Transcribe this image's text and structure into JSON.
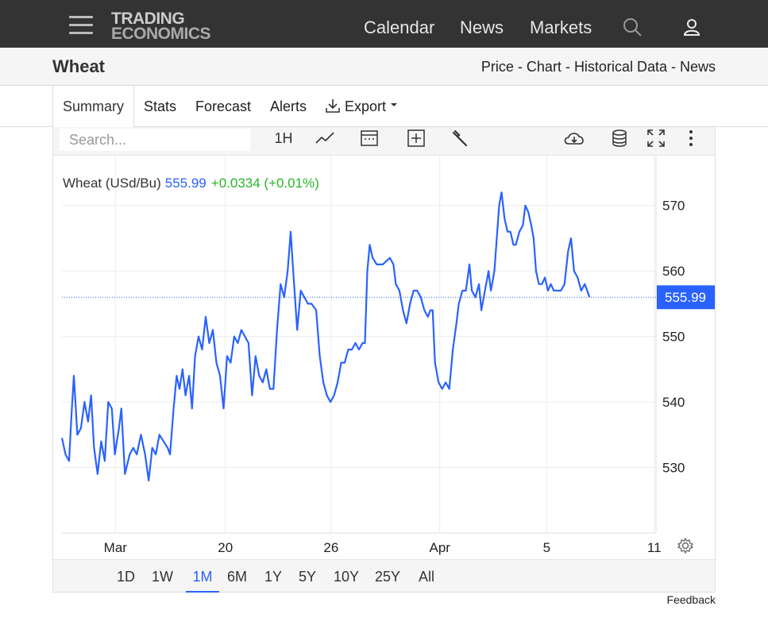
{
  "header": {
    "logo_line1": "TRADING",
    "logo_line2": "ECONOMICS",
    "nav": [
      "Calendar",
      "News",
      "Markets"
    ],
    "icons": [
      "menu-icon",
      "search-icon",
      "user-icon"
    ]
  },
  "subheader": {
    "title": "Wheat",
    "links": [
      "Price",
      "Chart",
      "Historical Data",
      "News"
    ],
    "separator": " - "
  },
  "tabs": {
    "summary": "Summary",
    "stats": "Stats",
    "forecast": "Forecast",
    "alerts": "Alerts",
    "export": "Export"
  },
  "toolbar": {
    "search_placeholder": "Search...",
    "interval": "1H",
    "icons": [
      "line-chart-icon",
      "calendar-icon",
      "add-indicator-icon",
      "wrench-icon",
      "download-icon",
      "database-icon",
      "fullscreen-icon",
      "more-icon"
    ]
  },
  "legend": {
    "name": "Wheat (USd/Bu)",
    "price": "555.99",
    "change": "+0.0334 (+0.01%)"
  },
  "chart_data": {
    "type": "line",
    "title": "Wheat (USd/Bu)",
    "last_value": 555.99,
    "last_label": "555.99",
    "ylim": [
      520,
      577
    ],
    "y_ticks": [
      530,
      540,
      550,
      560,
      570
    ],
    "x_tick_labels": [
      {
        "label": "Mar",
        "t": 0.09
      },
      {
        "label": "20",
        "t": 0.275
      },
      {
        "label": "26",
        "t": 0.453
      },
      {
        "label": "Apr",
        "t": 0.636
      },
      {
        "label": "5",
        "t": 0.816
      },
      {
        "label": "11",
        "t": 0.997
      }
    ],
    "grid": true,
    "line_color": "#2962ff",
    "series": [
      {
        "name": "Wheat (USd/Bu)",
        "points": [
          [
            0.0,
            534.5
          ],
          [
            0.006,
            532
          ],
          [
            0.012,
            531
          ],
          [
            0.016,
            538
          ],
          [
            0.02,
            544
          ],
          [
            0.026,
            535
          ],
          [
            0.032,
            536
          ],
          [
            0.038,
            540
          ],
          [
            0.044,
            537
          ],
          [
            0.049,
            541
          ],
          [
            0.054,
            533
          ],
          [
            0.06,
            529
          ],
          [
            0.066,
            534
          ],
          [
            0.072,
            531
          ],
          [
            0.078,
            540
          ],
          [
            0.084,
            539
          ],
          [
            0.089,
            532
          ],
          [
            0.096,
            536
          ],
          [
            0.1,
            539
          ],
          [
            0.106,
            529
          ],
          [
            0.114,
            532
          ],
          [
            0.12,
            533
          ],
          [
            0.126,
            532
          ],
          [
            0.133,
            535
          ],
          [
            0.14,
            532
          ],
          [
            0.146,
            528
          ],
          [
            0.152,
            533
          ],
          [
            0.158,
            532
          ],
          [
            0.164,
            535
          ],
          [
            0.171,
            534
          ],
          [
            0.178,
            533
          ],
          [
            0.182,
            532
          ],
          [
            0.188,
            539
          ],
          [
            0.193,
            544
          ],
          [
            0.198,
            542
          ],
          [
            0.203,
            545
          ],
          [
            0.208,
            541
          ],
          [
            0.214,
            544
          ],
          [
            0.219,
            539
          ],
          [
            0.224,
            547
          ],
          [
            0.23,
            550
          ],
          [
            0.236,
            548
          ],
          [
            0.242,
            553
          ],
          [
            0.248,
            549
          ],
          [
            0.254,
            551
          ],
          [
            0.26,
            546
          ],
          [
            0.266,
            544
          ],
          [
            0.272,
            539
          ],
          [
            0.278,
            547
          ],
          [
            0.284,
            546
          ],
          [
            0.29,
            550
          ],
          [
            0.296,
            549
          ],
          [
            0.302,
            551
          ],
          [
            0.308,
            550
          ],
          [
            0.314,
            549
          ],
          [
            0.32,
            541
          ],
          [
            0.326,
            547
          ],
          [
            0.332,
            544
          ],
          [
            0.338,
            543
          ],
          [
            0.344,
            545
          ],
          [
            0.35,
            542
          ],
          [
            0.356,
            542
          ],
          [
            0.362,
            551
          ],
          [
            0.368,
            558
          ],
          [
            0.374,
            556
          ],
          [
            0.38,
            560
          ],
          [
            0.385,
            566
          ],
          [
            0.39,
            559
          ],
          [
            0.396,
            551
          ],
          [
            0.402,
            557
          ],
          [
            0.408,
            556
          ],
          [
            0.414,
            555
          ],
          [
            0.42,
            555
          ],
          [
            0.428,
            554
          ],
          [
            0.434,
            547
          ],
          [
            0.44,
            543
          ],
          [
            0.446,
            541
          ],
          [
            0.452,
            540
          ],
          [
            0.458,
            541
          ],
          [
            0.464,
            543
          ],
          [
            0.47,
            546
          ],
          [
            0.476,
            546
          ],
          [
            0.482,
            548
          ],
          [
            0.488,
            548
          ],
          [
            0.494,
            549
          ],
          [
            0.5,
            548
          ],
          [
            0.506,
            549
          ],
          [
            0.51,
            549
          ],
          [
            0.514,
            560
          ],
          [
            0.518,
            564
          ],
          [
            0.523,
            562
          ],
          [
            0.53,
            561
          ],
          [
            0.54,
            561
          ],
          [
            0.552,
            562
          ],
          [
            0.558,
            561
          ],
          [
            0.562,
            558
          ],
          [
            0.568,
            557
          ],
          [
            0.574,
            554
          ],
          [
            0.58,
            552
          ],
          [
            0.586,
            555
          ],
          [
            0.592,
            557
          ],
          [
            0.598,
            557
          ],
          [
            0.604,
            556
          ],
          [
            0.61,
            554
          ],
          [
            0.616,
            553
          ],
          [
            0.62,
            554
          ],
          [
            0.624,
            554
          ],
          [
            0.628,
            546
          ],
          [
            0.634,
            543
          ],
          [
            0.64,
            542
          ],
          [
            0.646,
            543
          ],
          [
            0.652,
            542
          ],
          [
            0.658,
            548
          ],
          [
            0.664,
            552
          ],
          [
            0.668,
            555
          ],
          [
            0.674,
            557
          ],
          [
            0.68,
            557
          ],
          [
            0.686,
            561
          ],
          [
            0.69,
            557
          ],
          [
            0.696,
            556
          ],
          [
            0.702,
            558
          ],
          [
            0.706,
            554
          ],
          [
            0.712,
            557
          ],
          [
            0.718,
            560
          ],
          [
            0.722,
            557
          ],
          [
            0.728,
            560
          ],
          [
            0.732,
            565
          ],
          [
            0.736,
            570
          ],
          [
            0.74,
            572
          ],
          [
            0.745,
            568
          ],
          [
            0.75,
            566
          ],
          [
            0.755,
            566
          ],
          [
            0.76,
            564
          ],
          [
            0.764,
            564
          ],
          [
            0.77,
            566
          ],
          [
            0.776,
            567
          ],
          [
            0.78,
            570
          ],
          [
            0.785,
            569
          ],
          [
            0.79,
            567
          ],
          [
            0.794,
            565
          ],
          [
            0.798,
            560
          ],
          [
            0.803,
            558
          ],
          [
            0.808,
            558
          ],
          [
            0.813,
            559
          ],
          [
            0.818,
            557
          ],
          [
            0.823,
            558
          ],
          [
            0.828,
            557
          ],
          [
            0.834,
            557
          ],
          [
            0.84,
            557
          ],
          [
            0.846,
            558
          ],
          [
            0.852,
            563
          ],
          [
            0.857,
            565
          ],
          [
            0.862,
            560
          ],
          [
            0.868,
            559
          ],
          [
            0.874,
            557
          ],
          [
            0.88,
            558
          ],
          [
            0.885,
            556.8
          ],
          [
            0.888,
            556
          ]
        ]
      }
    ]
  },
  "range_buttons": {
    "items": [
      "1D",
      "1W",
      "1M",
      "6M",
      "1Y",
      "5Y",
      "10Y",
      "25Y",
      "All"
    ],
    "active": "1M"
  },
  "feedback": "Feedback"
}
